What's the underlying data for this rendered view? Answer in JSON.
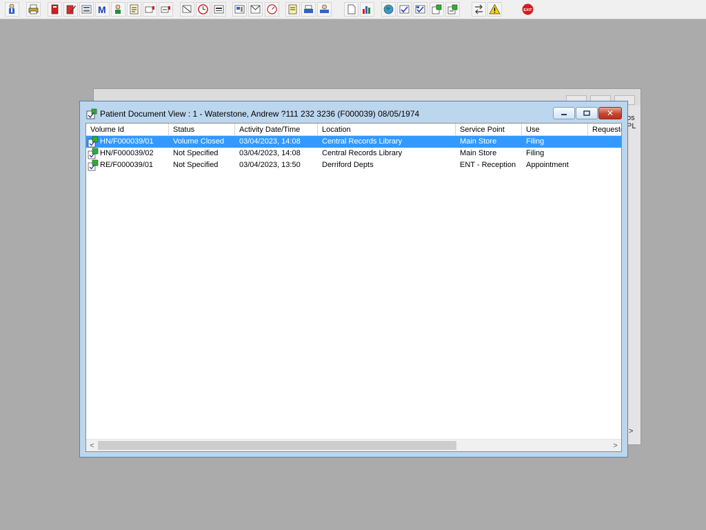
{
  "toolbar": {
    "buttons": [
      {
        "name": "patient-search-icon"
      },
      {
        "name": "print-icon"
      },
      {
        "name": "red-book-icon"
      },
      {
        "name": "notes-edit-icon"
      },
      {
        "name": "document-view-icon"
      },
      {
        "name": "m-letter-icon"
      },
      {
        "name": "person-icon"
      },
      {
        "name": "form-icon"
      },
      {
        "name": "card-flag-icon"
      },
      {
        "name": "card-flag-icon-2"
      },
      {
        "name": "tracking-icon"
      },
      {
        "name": "clock-icon"
      },
      {
        "name": "list-icon"
      },
      {
        "name": "report-icon"
      },
      {
        "name": "letter-icon"
      },
      {
        "name": "dial-icon"
      },
      {
        "name": "notepad-icon"
      },
      {
        "name": "transfer-icon"
      },
      {
        "name": "request-icon"
      },
      {
        "name": "page-icon"
      },
      {
        "name": "bar-chart-icon"
      },
      {
        "name": "globe-icon"
      },
      {
        "name": "check-doc-icon"
      },
      {
        "name": "check-doc-icon-2"
      },
      {
        "name": "green-doc-icon"
      },
      {
        "name": "green-doc-icon-2"
      },
      {
        "name": "swap-arrows-icon"
      },
      {
        "name": "warning-icon"
      },
      {
        "name": "exit-icon",
        "label": "EXIT"
      }
    ]
  },
  "back_window": {
    "right_fragment_top": "os",
    "right_fragment_bottom": "PL",
    "scroll_arrow": ">"
  },
  "window": {
    "title": "Patient Document View : 1 - Waterstone, Andrew ?111 232 3236 (F000039) 08/05/1974",
    "close_glyph": "✕"
  },
  "table": {
    "columns": [
      "Volume Id",
      "Status",
      "Activity Date/Time",
      "Location",
      "Service Point",
      "Use",
      "Requester"
    ],
    "rows": [
      [
        "HN/F000039/01",
        "Volume Closed",
        "03/04/2023, 14:08",
        "Central Records Library",
        "Main Store",
        "Filing"
      ],
      [
        "HN/F000039/02",
        "Not Specified",
        "03/04/2023, 14:08",
        "Central Records Library",
        "Main Store",
        "Filing"
      ],
      [
        "RE/F000039/01",
        "Not Specified",
        "03/04/2023, 13:50",
        "Derriford Depts",
        "ENT - Reception",
        "Appointment"
      ]
    ],
    "selected_row": 0
  },
  "scrollbar": {
    "left_arrow": "<",
    "right_arrow": ">"
  },
  "colors": {
    "selection": "#3399ff",
    "desktop": "#ababab",
    "title_bar": "#bcd6ee"
  }
}
